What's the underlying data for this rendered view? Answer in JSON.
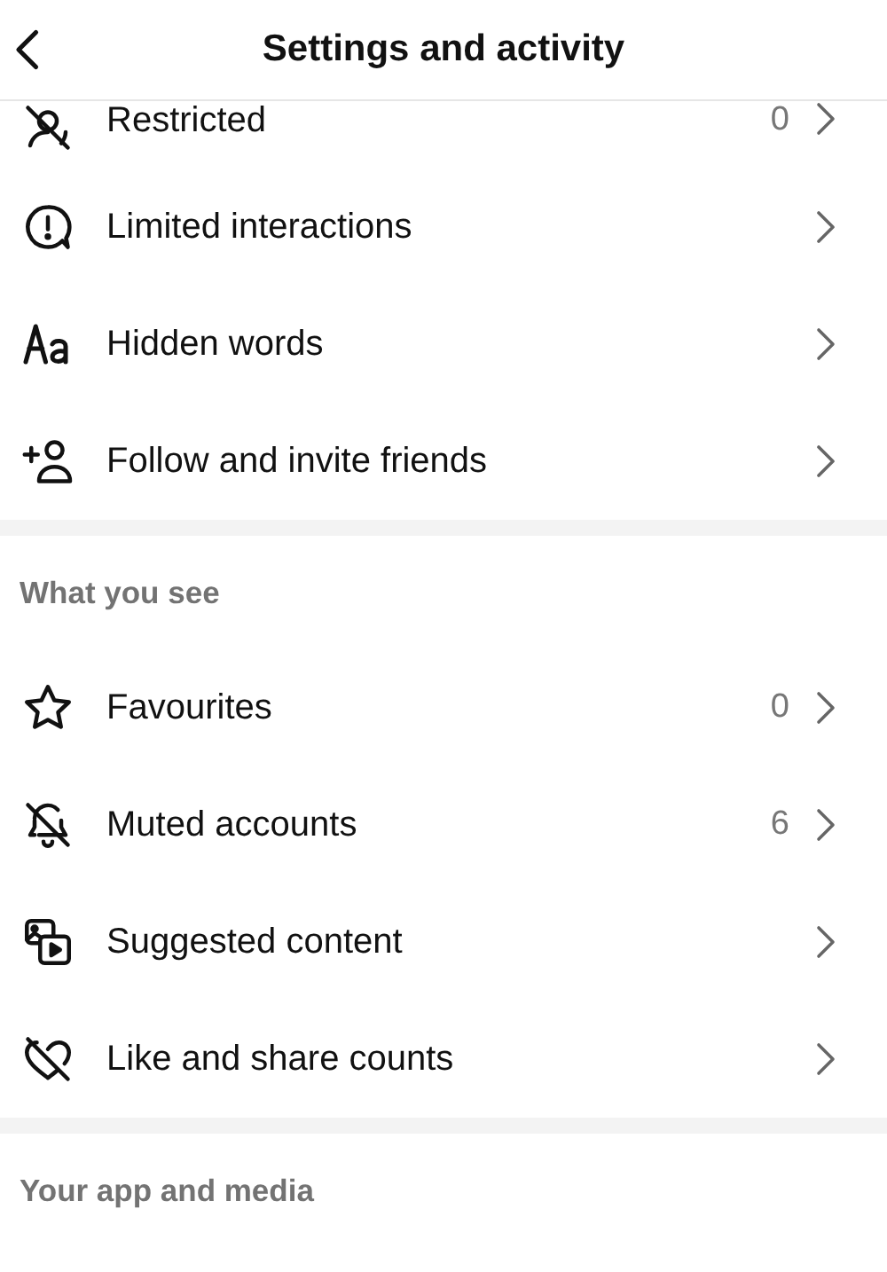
{
  "header": {
    "title": "Settings and activity"
  },
  "sections": [
    {
      "items": [
        {
          "label": "Restricted",
          "count": "0"
        },
        {
          "label": "Limited interactions"
        },
        {
          "label": "Hidden words"
        },
        {
          "label": "Follow and invite friends"
        }
      ]
    },
    {
      "title": "What you see",
      "items": [
        {
          "label": "Favourites",
          "count": "0"
        },
        {
          "label": "Muted accounts",
          "count": "6"
        },
        {
          "label": "Suggested content"
        },
        {
          "label": "Like and share counts"
        }
      ]
    },
    {
      "title": "Your app and media"
    }
  ]
}
